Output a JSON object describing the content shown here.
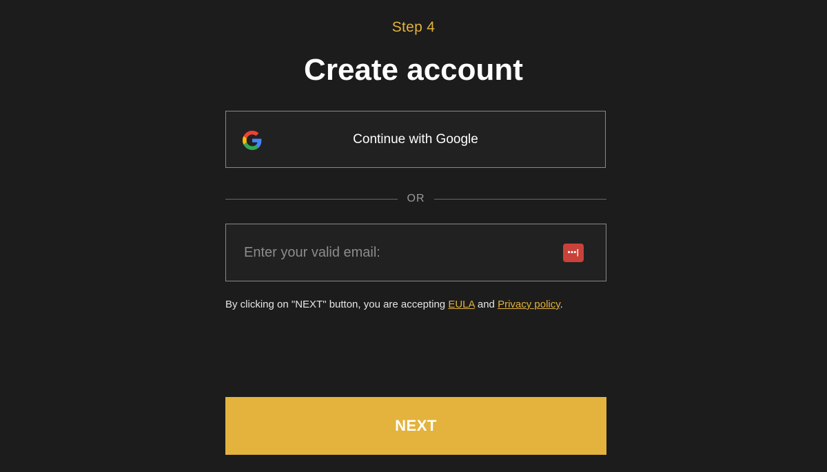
{
  "header": {
    "step": "Step 4",
    "title": "Create account"
  },
  "google_button": {
    "label": "Continue with Google",
    "icon": "google-g-icon"
  },
  "divider": {
    "label": "OR"
  },
  "email": {
    "value": "",
    "placeholder": "Enter your valid email:",
    "password_manager_icon": "password-manager-icon"
  },
  "terms": {
    "prefix": "By clicking on \"NEXT\" button, you are accepting ",
    "eula_label": "EULA",
    "conjunction": " and ",
    "privacy_label": "Privacy policy",
    "suffix": "."
  },
  "next_button": {
    "label": "NEXT"
  },
  "colors": {
    "background": "#1c1c1c",
    "accent": "#e3b23c",
    "field_border": "#8a8a8a",
    "password_icon": "#c8423a"
  }
}
